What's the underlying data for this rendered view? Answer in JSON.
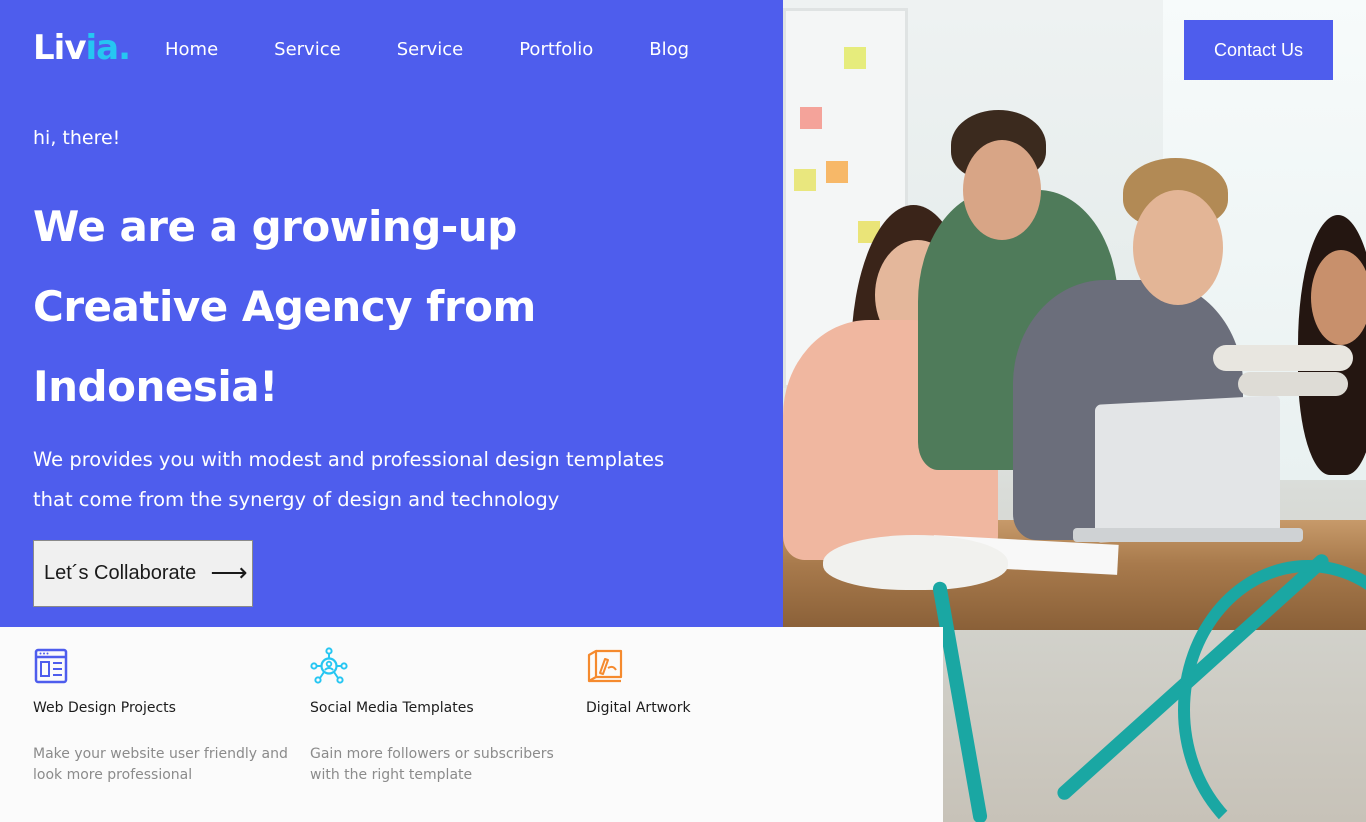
{
  "brand": {
    "logo_main": "Liv",
    "logo_accent": "ia",
    "logo_dot": ".",
    "accent_color": "#26c6f2",
    "primary_color": "#4e5ded"
  },
  "nav": {
    "items": [
      {
        "label": "Home"
      },
      {
        "label": "Service"
      },
      {
        "label": "Service"
      },
      {
        "label": "Portfolio"
      },
      {
        "label": "Blog"
      }
    ],
    "contact_label": "Contact Us"
  },
  "hero": {
    "greeting": "hi, there!",
    "headline_lines": [
      "We are a growing-up",
      "Creative Agency from",
      "Indonesia!"
    ],
    "lead_lines": [
      "We provides you with modest and professional design templates",
      "that come from the synergy of design and technology"
    ],
    "cta_label": "Let´s Collaborate",
    "cta_icon": "arrow-right-icon"
  },
  "features": [
    {
      "icon": "web-design-icon",
      "color": "#4e5ded",
      "title": "Web Design Projects",
      "description": "Make your website user friendly and look more professional"
    },
    {
      "icon": "social-network-icon",
      "color": "#26c6f2",
      "title": "Social Media Templates",
      "description": "Gain more followers or subscribers with the right template"
    },
    {
      "icon": "digital-artwork-icon",
      "color": "#f58a2e",
      "title": "Digital Artwork",
      "description": ""
    }
  ],
  "photo": {
    "subject": "team-working-on-laptop-photo"
  }
}
